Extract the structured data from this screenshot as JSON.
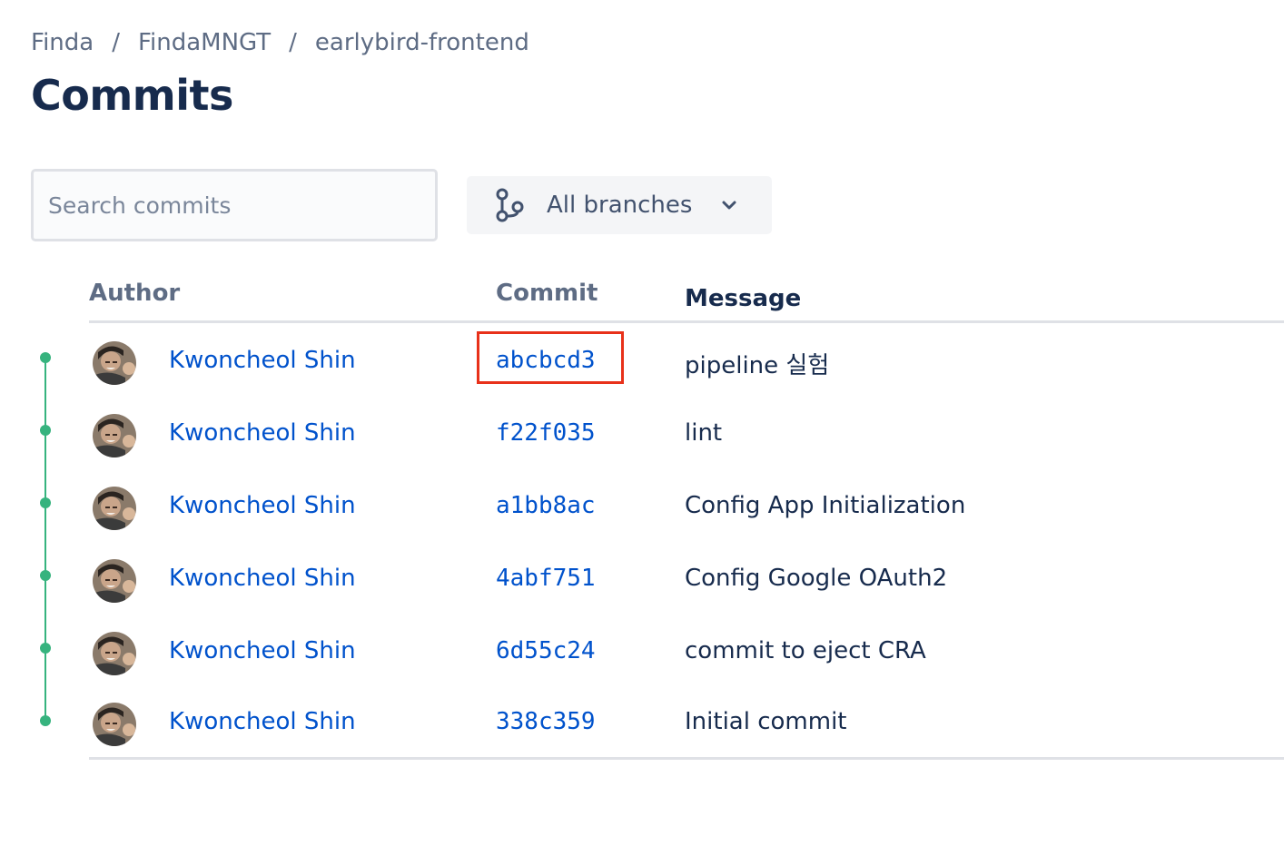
{
  "breadcrumb": {
    "items": [
      "Finda",
      "FindaMNGT",
      "earlybird-frontend"
    ],
    "separator": "/"
  },
  "page_title": "Commits",
  "search": {
    "placeholder": "Search commits",
    "value": ""
  },
  "branch_filter": {
    "label": "All branches",
    "icon": "branch-icon",
    "chevron": "chevron-down-icon"
  },
  "table": {
    "headers": {
      "author": "Author",
      "commit": "Commit",
      "message": "Message"
    },
    "rows": [
      {
        "author": "Kwoncheol Shin",
        "hash": "abcbcd3",
        "message": "pipeline 실험",
        "highlighted": true
      },
      {
        "author": "Kwoncheol Shin",
        "hash": "f22f035",
        "message": "lint",
        "highlighted": false
      },
      {
        "author": "Kwoncheol Shin",
        "hash": "a1bb8ac",
        "message": "Config App Initialization",
        "highlighted": false
      },
      {
        "author": "Kwoncheol Shin",
        "hash": "4abf751",
        "message": "Config Google OAuth2",
        "highlighted": false
      },
      {
        "author": "Kwoncheol Shin",
        "hash": "6d55c24",
        "message": "commit to eject CRA",
        "highlighted": false
      },
      {
        "author": "Kwoncheol Shin",
        "hash": "338c359",
        "message": "Initial commit",
        "highlighted": false
      }
    ]
  },
  "colors": {
    "graph_line": "#36b37e",
    "link": "#0052cc",
    "highlight_border": "#e8311a",
    "heading": "#172b4d",
    "muted": "#5e6c84"
  }
}
